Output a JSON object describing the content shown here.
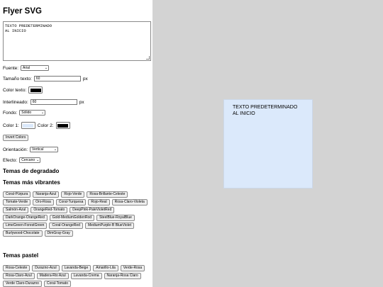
{
  "title": "Flyer SVG",
  "textarea_value": "TEXTO PREDETERMINADO\nAL INICIO",
  "font": {
    "label": "Fuente:",
    "value": "Arial"
  },
  "size": {
    "label": "Tamaño texto:",
    "value": "60",
    "unit": "px"
  },
  "text_color": {
    "label": "Color texto:",
    "color": "#000000"
  },
  "line_height": {
    "label": "Interlineado:",
    "value": "60",
    "unit": "px"
  },
  "background": {
    "label": "Fondo:",
    "value": "Sólido"
  },
  "color1": {
    "label": "Color 1:",
    "color": "#dbe9fb"
  },
  "color2": {
    "label": "Color 2:",
    "color": "#000000"
  },
  "invert_button": "Invert Colors",
  "orientation": {
    "label": "Orientación:",
    "value": "Vertical"
  },
  "effect": {
    "label": "Efecto:",
    "value": "Cercano"
  },
  "gradient_heading": "Temas de degradado",
  "vibrant_heading": "Temas más vibrantes",
  "vibrant_themes": [
    "Coral-Púrpura",
    "Naranja-Azul",
    "Rojo-Verde",
    "Rosa-Brillante-Celeste",
    "Tomate-Verde",
    "Oro-Rosa",
    "Coral-Turquesa",
    "Rojo-Real",
    "Rosa-Claro-Violeta",
    "Salmón-Azul",
    "OrangeRed-Tomato",
    "DeepPink-PaleVioletRed",
    "DarkOrange-OrangeRed",
    "Gold-MediumGoldenRod",
    "SteelBlue-RoyalBlue",
    "LimeGreen-ForestGreen",
    "Coral-OrangeRed",
    "MediumPurple-B BlueViolet",
    "Burlywood-Chocolate",
    "DimGray-Gray"
  ],
  "pastel_heading": "Temas pastel",
  "pastel_themes": [
    "Rosa-Celeste",
    "Durazno-Azul",
    "Lavanda-Beige",
    "Amarillo-Lila",
    "Verde-Rosa",
    "Rosa-Claro-Azul",
    "Madera-Rio Azul",
    "Lavanda-Crema",
    "Naranja-Rosa Claro",
    "Verde Claro-Durazno",
    "Coral-Tomato"
  ],
  "preview": {
    "line1": "TEXTO PREDETERMINADO",
    "line2": "AL INICIO"
  }
}
